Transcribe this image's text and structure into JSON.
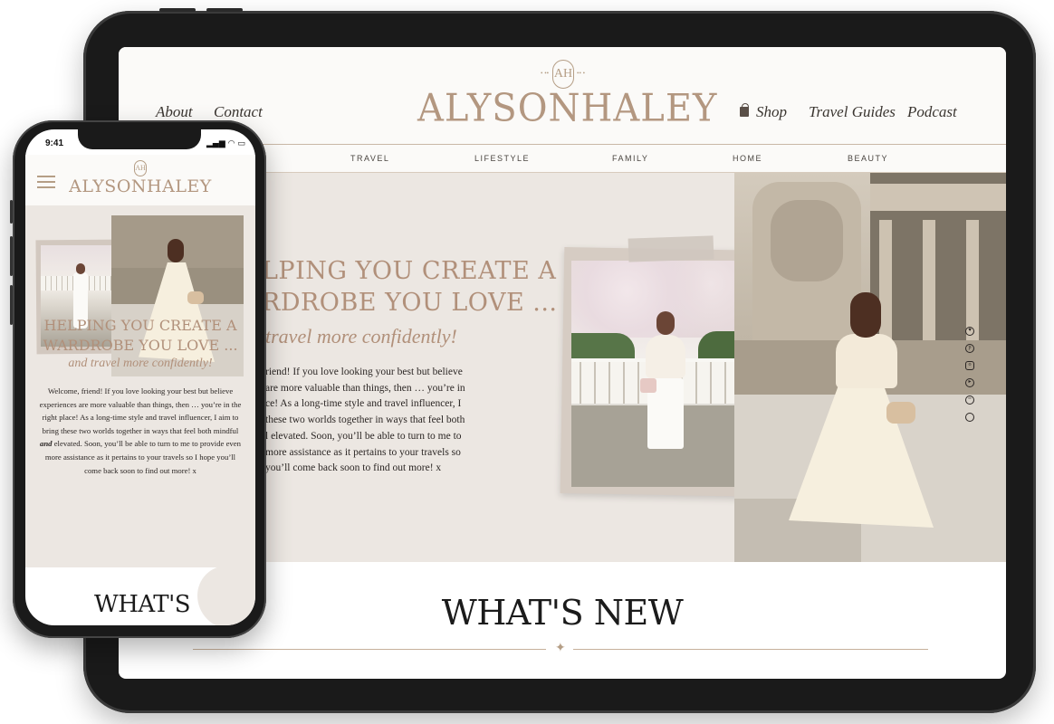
{
  "tablet": {
    "nav_left": [
      "About",
      "Contact"
    ],
    "monogram": "AH",
    "logo": "ALYSONHALEY",
    "nav_right": {
      "shop": "Shop",
      "travel_guides": "Travel Guides",
      "podcast": "Podcast"
    },
    "categories": [
      "TRAVEL",
      "LIFESTYLE",
      "FAMILY",
      "HOME",
      "BEAUTY"
    ],
    "hero": {
      "headline_1": "LPING YOU CREATE A",
      "headline_2": "RDROBE YOU LOVE ...",
      "subheadline": "travel more confidently!",
      "body": "riend! If you love looking your best but believe\nare more valuable than things, then … you’re in\nce! As a long-time style and travel influencer, I\nthese two worlds together in ways that feel both\nl elevated. Soon, you’ll be able to turn to me to\nmore assistance as it pertains to your travels so\nyou’ll come back soon to find out more! x"
    },
    "social_icons": [
      "heart-icon",
      "pinterest-icon",
      "instagram-icon",
      "youtube-icon",
      "spotify-icon",
      "search-icon"
    ],
    "section_title": "WHAT'S NEW"
  },
  "phone": {
    "time": "9:41",
    "status_icons": "▂▄▆ ◠ ▭",
    "monogram": "AH",
    "logo": "ALYSONHALEY",
    "hero": {
      "headline": "HELPING YOU CREATE A\nWARDROBE YOU LOVE ...",
      "subheadline": "and travel more confidently!",
      "body_1": "Welcome, friend! If you love looking your best but believe experiences are more valuable than things, then … you’re in the right place! As a long-time style and travel influencer, I aim to bring these two worlds together in ways that feel both mindful ",
      "body_em": "and",
      "body_2": " elevated. Soon, you’ll be able to turn to me to provide even more assistance as it pertains to your travels so I hope you’ll come back soon to find out more! x"
    },
    "section_title": "WHAT'S"
  },
  "colors": {
    "accent": "#b1907a",
    "logo": "#b39780",
    "hero_bg": "#ece7e2",
    "device_frame": "#1a1a1a"
  }
}
